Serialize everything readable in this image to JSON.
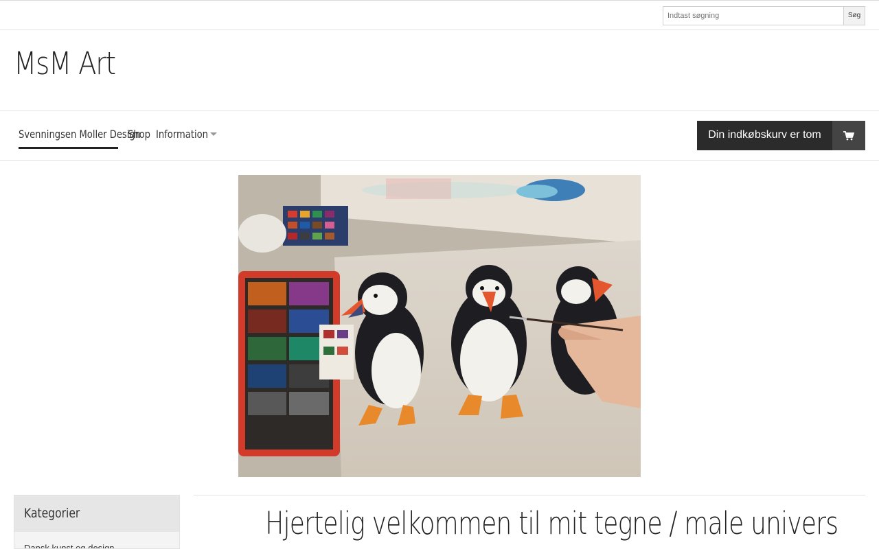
{
  "search": {
    "placeholder": "Indtast søgning",
    "button_label": "Søg"
  },
  "site": {
    "title": "MsM Art"
  },
  "nav": {
    "items": [
      {
        "label": "Svenningsen Moller Design",
        "active": true
      },
      {
        "label": "Shop",
        "active": false
      },
      {
        "label": "Information",
        "active": false,
        "has_dropdown": true
      }
    ]
  },
  "cart": {
    "label": "Din indkøbskurv er tom",
    "icon": "shopping-cart-icon"
  },
  "hero": {
    "image": "watercolor-puffins-painting-photo"
  },
  "sidebar": {
    "heading": "Kategorier",
    "first_item": "Dansk kunst og design"
  },
  "main": {
    "heading": "Hjertelig velkommen til mit tegne / male univers"
  },
  "colors": {
    "cart_bg": "#2b2b2b",
    "cart_icon_bg": "#444444",
    "active_underline": "#222222"
  }
}
